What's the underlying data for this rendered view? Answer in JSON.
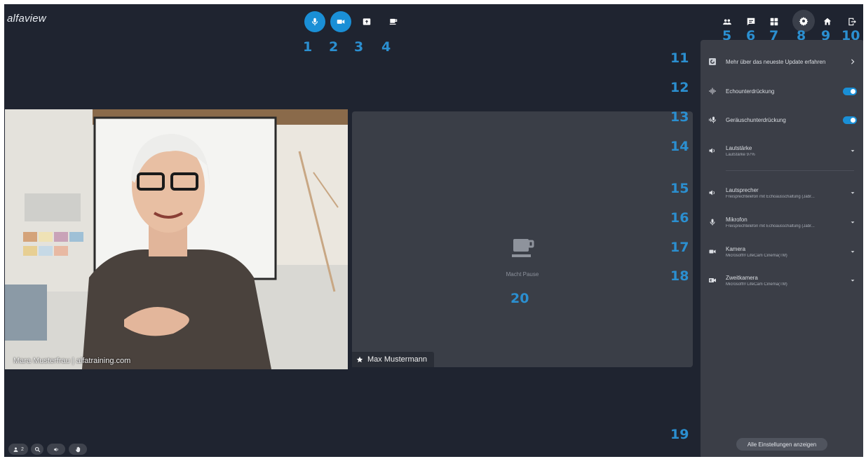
{
  "app": {
    "logo": "alfaview"
  },
  "toolbar": {
    "buttons": [
      {
        "name": "microphone",
        "icon": "microphone-icon",
        "active": true
      },
      {
        "name": "camera",
        "icon": "camera-icon",
        "active": true
      },
      {
        "name": "screen-share",
        "icon": "screen-share-icon",
        "active": false
      },
      {
        "name": "break",
        "icon": "coffee-cup-icon",
        "active": false
      }
    ]
  },
  "top_right": [
    {
      "name": "participants",
      "icon": "people-icon"
    },
    {
      "name": "chat",
      "icon": "chat-icon"
    },
    {
      "name": "layout",
      "icon": "grid-icon"
    },
    {
      "name": "settings",
      "icon": "gear-icon",
      "active": true
    },
    {
      "name": "home",
      "icon": "home-icon"
    },
    {
      "name": "leave",
      "icon": "exit-icon"
    }
  ],
  "callouts": [
    "1",
    "2",
    "3",
    "4",
    "5",
    "6",
    "7",
    "8",
    "9",
    "10",
    "11",
    "12",
    "13",
    "14",
    "15",
    "16",
    "17",
    "18",
    "19",
    "20"
  ],
  "video": {
    "left_name": "Mara Musterfrau | alfatraining.com",
    "right_name": "Max Mustermann",
    "right_status": "Macht Pause"
  },
  "settings": {
    "update": "Mehr über das neueste Update erfahren",
    "echo": "Echounterdrückung",
    "noise": "Geräuschunterdrückung",
    "volume": {
      "label": "Lautstärke",
      "sub": "Lautstärke 97%"
    },
    "speaker": {
      "label": "Lautsprecher",
      "sub": "Freisprechtelefon mit Echoausschaltung (Jabr..."
    },
    "mic": {
      "label": "Mikrofon",
      "sub": "Freisprechtelefon mit Echoausschaltung (Jabr..."
    },
    "camera": {
      "label": "Kamera",
      "sub": "Microsoft® LifeCam Cinema(TM)"
    },
    "second_camera": {
      "label": "Zweitkamera",
      "sub": "Microsoft® LifeCam Cinema(TM)"
    },
    "all_settings": "Alle Einstellungen anzeigen"
  },
  "bottom": {
    "participants_count": "2"
  },
  "colors": {
    "accent": "#1a8fd6",
    "callout": "#2b8fd0",
    "background": "#1f2430",
    "panel": "#3b3e47"
  }
}
